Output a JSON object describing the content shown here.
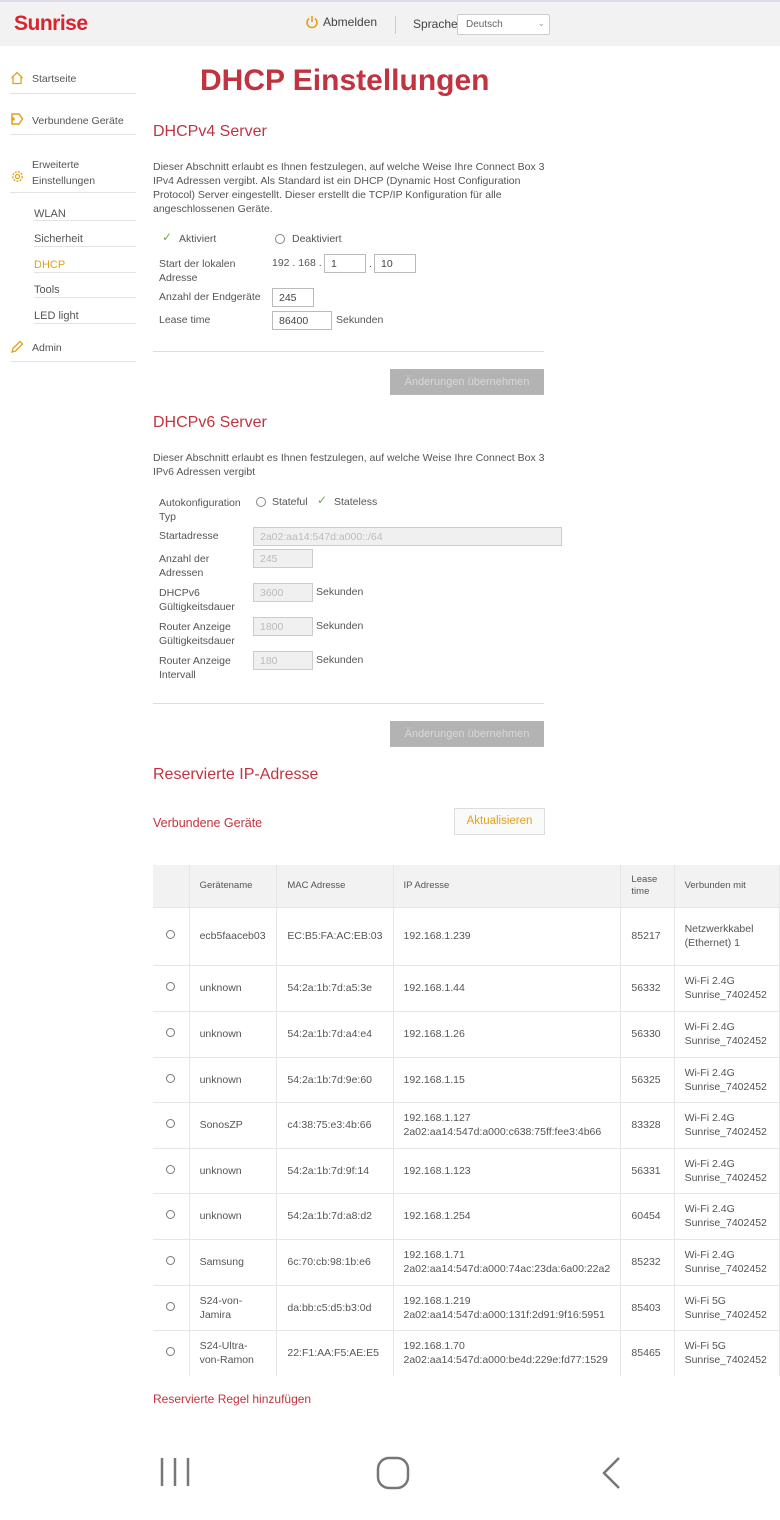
{
  "header": {
    "logo": "Sunrise",
    "logout_label": "Abmelden",
    "language_label": "Sprache",
    "language_value": "Deutsch"
  },
  "sidebar": {
    "items": [
      {
        "label": "Startseite",
        "icon": "home-icon"
      },
      {
        "label": "Verbundene Geräte",
        "icon": "devices-icon"
      },
      {
        "label": "Erweiterte Einstellungen",
        "icon": "gear-icon"
      },
      {
        "label": "Admin",
        "icon": "pencil-icon"
      }
    ],
    "subitems": [
      {
        "label": "WLAN",
        "active": false
      },
      {
        "label": "Sicherheit",
        "active": false
      },
      {
        "label": "DHCP",
        "active": true
      },
      {
        "label": "Tools",
        "active": false
      },
      {
        "label": "LED light",
        "active": false
      }
    ],
    "advanced_line1": "Erweiterte",
    "advanced_line2": "Einstellungen"
  },
  "page_title": "DHCP Einstellungen",
  "v4": {
    "title": "DHCPv4 Server",
    "desc": "Dieser Abschnitt erlaubt es Ihnen festzulegen, auf welche Weise Ihre Connect Box 3 IPv4 Adressen vergibt. Als Standard ist ein DHCP (Dynamic Host Configuration Protocol) Server eingestellt. Dieser erstellt die TCP/IP Konfiguration für alle angeschlossenen Geräte.",
    "enabled_label": "Aktiviert",
    "disabled_label": "Deaktiviert",
    "start_label": "Start der lokalen Adresse",
    "ip_prefix": "192 . 168 .",
    "ip3": "1",
    "ip_dot": ".",
    "ip4": "10",
    "count_label": "Anzahl der Endgeräte",
    "count_value": "245",
    "lease_label": "Lease time",
    "lease_value": "86400",
    "lease_unit": "Sekunden",
    "apply_label": "Änderungen übernehmen"
  },
  "v6": {
    "title": "DHCPv6 Server",
    "desc": "Dieser Abschnitt erlaubt es Ihnen festzulegen, auf welche Weise Ihre Connect Box 3 IPv6 Adressen vergibt",
    "autoconf_label": "Autokonfiguration Typ",
    "stateful_label": "Stateful",
    "stateless_label": "Stateless",
    "start_label": "Startadresse",
    "start_value": "2a02:aa14:547d:a000::/64",
    "count_label": "Anzahl der Adressen",
    "count_value": "245",
    "validity_label": "DHCPv6 Gültigkeitsdauer",
    "validity_value": "3600",
    "ra_validity_label": "Router Anzeige Gültigkeitsdauer",
    "ra_validity_value": "1800",
    "ra_interval_label": "Router Anzeige Intervall",
    "ra_interval_value": "180",
    "unit": "Sekunden",
    "apply_label": "Änderungen übernehmen"
  },
  "reserved": {
    "title": "Reservierte IP-Adresse",
    "connected_title": "Verbundene Geräte",
    "refresh_label": "Aktualisieren",
    "add_rule_label": "Reservierte Regel hinzufügen",
    "columns": [
      "Gerätename",
      "MAC Adresse",
      "IP Adresse",
      "Lease time",
      "Verbunden mit"
    ],
    "rows": [
      {
        "name": "ecb5faaceb03",
        "mac": "EC:B5:FA:AC:EB:03",
        "ip": "192.168.1.239",
        "ip6": "",
        "lease": "85217",
        "conn": "Netzwerkkabel (Ethernet) 1"
      },
      {
        "name": "unknown",
        "mac": "54:2a:1b:7d:a5:3e",
        "ip": "192.168.1.44",
        "ip6": "",
        "lease": "56332",
        "conn": "Wi-Fi 2.4G Sunrise_7402452"
      },
      {
        "name": "unknown",
        "mac": "54:2a:1b:7d:a4:e4",
        "ip": "192.168.1.26",
        "ip6": "",
        "lease": "56330",
        "conn": "Wi-Fi 2.4G Sunrise_7402452"
      },
      {
        "name": "unknown",
        "mac": "54:2a:1b:7d:9e:60",
        "ip": "192.168.1.15",
        "ip6": "",
        "lease": "56325",
        "conn": "Wi-Fi 2.4G Sunrise_7402452"
      },
      {
        "name": "SonosZP",
        "mac": "c4:38:75:e3:4b:66",
        "ip": "192.168.1.127",
        "ip6": "2a02:aa14:547d:a000:c638:75ff:fee3:4b66",
        "lease": "83328",
        "conn": "Wi-Fi 2.4G Sunrise_7402452"
      },
      {
        "name": "unknown",
        "mac": "54:2a:1b:7d:9f:14",
        "ip": "192.168.1.123",
        "ip6": "",
        "lease": "56331",
        "conn": "Wi-Fi 2.4G Sunrise_7402452"
      },
      {
        "name": "unknown",
        "mac": "54:2a:1b:7d:a8:d2",
        "ip": "192.168.1.254",
        "ip6": "",
        "lease": "60454",
        "conn": "Wi-Fi 2.4G Sunrise_7402452"
      },
      {
        "name": "Samsung",
        "mac": "6c:70:cb:98:1b:e6",
        "ip": "192.168.1.71",
        "ip6": "2a02:aa14:547d:a000:74ac:23da:6a00:22a2",
        "lease": "85232",
        "conn": "Wi-Fi 2.4G Sunrise_7402452"
      },
      {
        "name": "S24-von-Jamira",
        "mac": "da:bb:c5:d5:b3:0d",
        "ip": "192.168.1.219",
        "ip6": "2a02:aa14:547d:a000:131f:2d91:9f16:5951",
        "lease": "85403",
        "conn": "Wi-Fi 5G Sunrise_7402452"
      },
      {
        "name": "S24-Ultra-von-Ramon",
        "mac": "22:F1:AA:F5:AE:E5",
        "ip": "192.168.1.70",
        "ip6": "2a02:aa14:547d:a000:be4d:229e:fd77:1529",
        "lease": "85465",
        "conn": "Wi-Fi 5G Sunrise_7402452"
      }
    ]
  },
  "colors": {
    "brand": "#d9232e",
    "heading": "#c1343f",
    "accent": "#e2a11a",
    "check": "#7aa84a"
  }
}
